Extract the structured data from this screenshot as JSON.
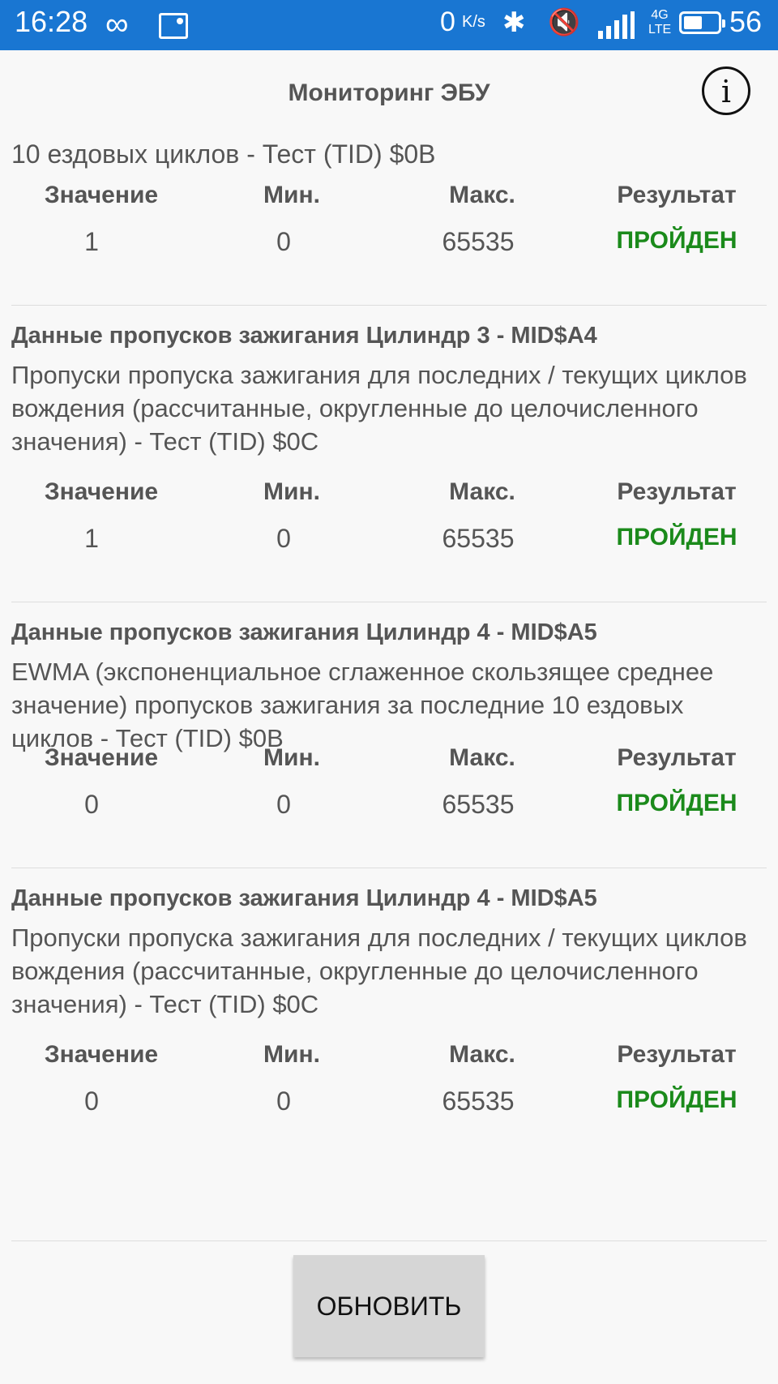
{
  "status_bar": {
    "time": "16:28",
    "infinity_icon": "∞",
    "speed": "0",
    "speed_unit": "K/s",
    "bluetooth_icon": "✱",
    "mute_icon": "🔇",
    "network_top": "4G",
    "network_bottom": "LTE",
    "battery_level": 0.56,
    "battery_percent": "56"
  },
  "header": {
    "title": "Мониторинг ЭБУ",
    "info_icon": "i"
  },
  "columns": {
    "value": "Значение",
    "min": "Мин.",
    "max": "Макс.",
    "result": "Результат"
  },
  "partial_top_text": "10 ездовых циклов - Тест (TID) $0B",
  "items": [
    {
      "value": "1",
      "min": "0",
      "max": "65535",
      "result": "ПРОЙДЕН"
    },
    {
      "title": "Данные пропусков зажигания Цилиндр 3 - MID$A4",
      "description": "Пропуски пропуска зажигания для последних / текущих циклов вождения (рассчитанные, округленные до целочисленного значения) - Тест (TID) $0C",
      "value": "1",
      "min": "0",
      "max": "65535",
      "result": "ПРОЙДЕН"
    },
    {
      "title": "Данные пропусков зажигания Цилиндр 4 - MID$A5",
      "description": "EWMA (экспоненциальное сглаженное скользящее среднее значение) пропусков зажигания за последние 10 ездовых циклов - Тест (TID) $0B",
      "value": "0",
      "min": "0",
      "max": "65535",
      "result": "ПРОЙДЕН"
    },
    {
      "title": "Данные пропусков зажигания Цилиндр 4 - MID$A5",
      "description": "Пропуски пропуска зажигания для последних / текущих циклов вождения (рассчитанные, округленные до целочисленного значения) - Тест (TID) $0C",
      "value": "0",
      "min": "0",
      "max": "65535",
      "result": "ПРОЙДЕН"
    }
  ],
  "footer": {
    "refresh_label": "ОБНОВИТЬ"
  }
}
